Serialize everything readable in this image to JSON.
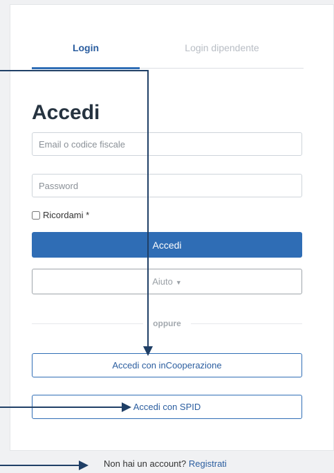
{
  "tabs": {
    "login": "Login",
    "login_employee": "Login dipendente"
  },
  "form": {
    "title": "Accedi",
    "email_placeholder": "Email o codice fiscale",
    "password_placeholder": "Password",
    "remember_label": "Ricordami *",
    "submit_label": "Accedi",
    "help_label": "Aiuto",
    "divider_label": "oppure",
    "incooperazione_label": "Accedi con inCooperazione",
    "spid_label": "Accedi con SPID"
  },
  "footer": {
    "text": "Non hai un account?",
    "link": "Registrati"
  },
  "colors": {
    "primary": "#2f6db5",
    "annotation_arrow": "#1f3f66"
  }
}
